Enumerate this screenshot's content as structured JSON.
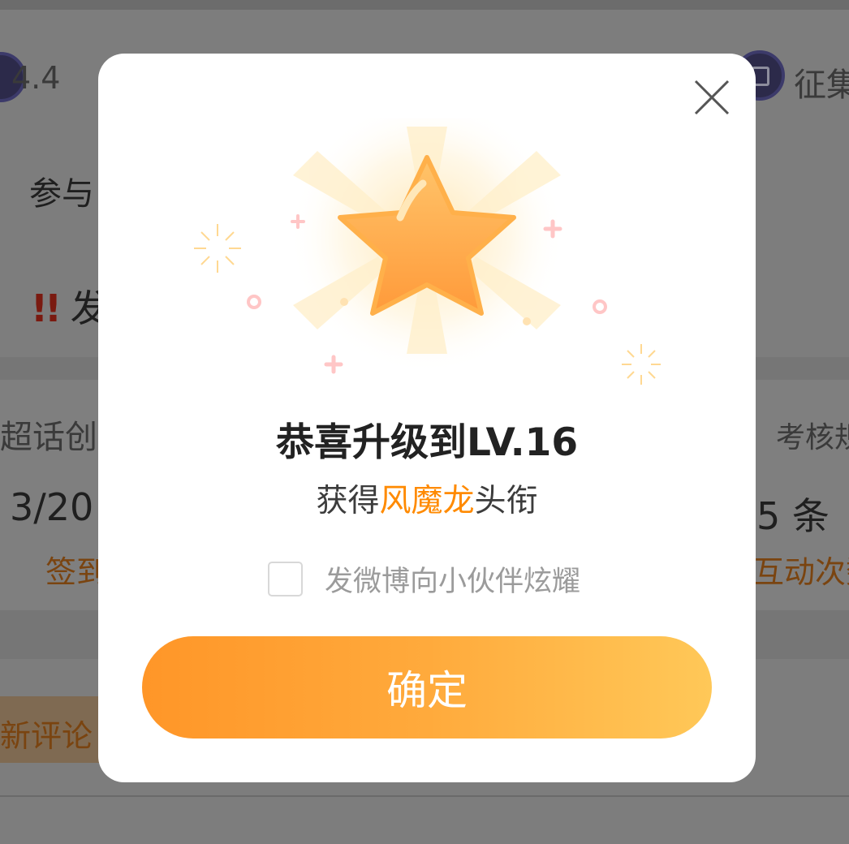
{
  "background": {
    "stats_row": {
      "value": "4.4",
      "collect_label": "征集"
    },
    "participate_text": "参与",
    "notice_text": "发",
    "card": {
      "left_label": "超话创",
      "left_value": "3/20",
      "left_action": "签到",
      "right_label": "考核规",
      "right_value": "5 条",
      "right_action": "互动次数"
    },
    "new_comment": "新评论"
  },
  "modal": {
    "title": "恭喜升级到LV.16",
    "subtitle_prefix": "获得",
    "subtitle_highlight": "风魔龙",
    "subtitle_suffix": "头衔",
    "share_checkbox_label": "发微博向小伙伴炫耀",
    "share_checked": false,
    "confirm_label": "确定"
  },
  "icons": [
    "close-icon",
    "star-icon",
    "gift-icon",
    "firework-icon",
    "sparkle-plus-icon",
    "ring-icon"
  ],
  "colors": {
    "accent": "#ff8a00",
    "button_start": "#ff9628",
    "button_end": "#ffc858",
    "overlay_dim": "#7d7d7d"
  }
}
